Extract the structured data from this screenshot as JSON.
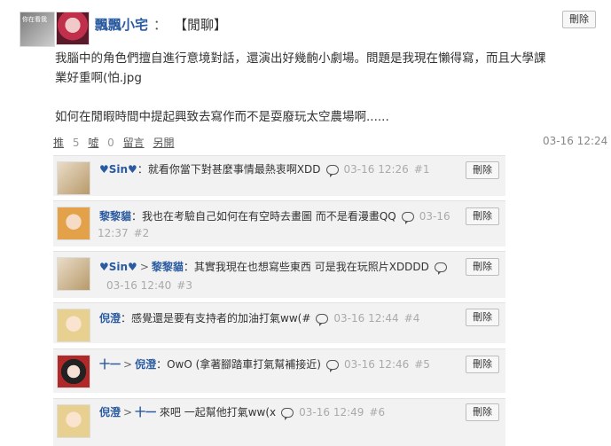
{
  "post": {
    "author": "飄飄小宅",
    "separator": "：",
    "mood": "【閒聊】",
    "avatar_text": "你在看我",
    "delete_label": "刪除",
    "body_line1": "我腦中的角色們擅自進行意境對話，還演出好幾齣小劇場。問題是我現在懶得寫，而且大學課",
    "body_line2": "業好重啊(怕.jpg",
    "body_line3": "如何在閒暇時間中提起興致去寫作而不是耍廢玩太空農場啊......",
    "push_label": "推",
    "push_count": "5",
    "boo_label": "噓",
    "boo_count": "0",
    "reply_label": "留言",
    "share_label": "另開",
    "time": "03-16 12:24"
  },
  "comments": [
    {
      "author": "♥Sin♥",
      "text": "：就看你當下對甚麼事情最熱衷啊XDD",
      "time": "03-16 12:26",
      "idx": "#1",
      "delete_label": "刪除"
    },
    {
      "author": "黎黎貓",
      "text": "：我也在考驗自己如何在有空時去畫圖 而不是看漫畫QQ",
      "time": "03-16",
      "time2": "12:37",
      "idx": "#2",
      "delete_label": "刪除"
    },
    {
      "author": "♥Sin♥",
      "arrow": ">",
      "target": "黎黎貓",
      "text": "：其實我現在也想寫些東西 可是我在玩照片XDDDD",
      "time": "03-16 12:40",
      "idx": "#3",
      "delete_label": "刪除"
    },
    {
      "author": "倪澄",
      "text": "：感覺還是要有支持者的加油打氣ww(#",
      "time": "03-16 12:44",
      "idx": "#4",
      "delete_label": "刪除"
    },
    {
      "author": "十一",
      "arrow": ">",
      "target": "倪澄",
      "text": "：OwO (拿著腳踏車打氣幫補接近)",
      "time": "03-16 12:46",
      "idx": "#5",
      "delete_label": "刪除"
    },
    {
      "author": "倪澄",
      "arrow": ">",
      "target": "十一",
      "text": " 來吧 一起幫他打氣ww(x",
      "time": "03-16 12:49",
      "idx": "#6",
      "delete_label": "刪除"
    }
  ],
  "colors": {
    "link": "#2a5aa0",
    "comment_bg": "#f2f2f2",
    "muted": "#aaaaaa"
  }
}
